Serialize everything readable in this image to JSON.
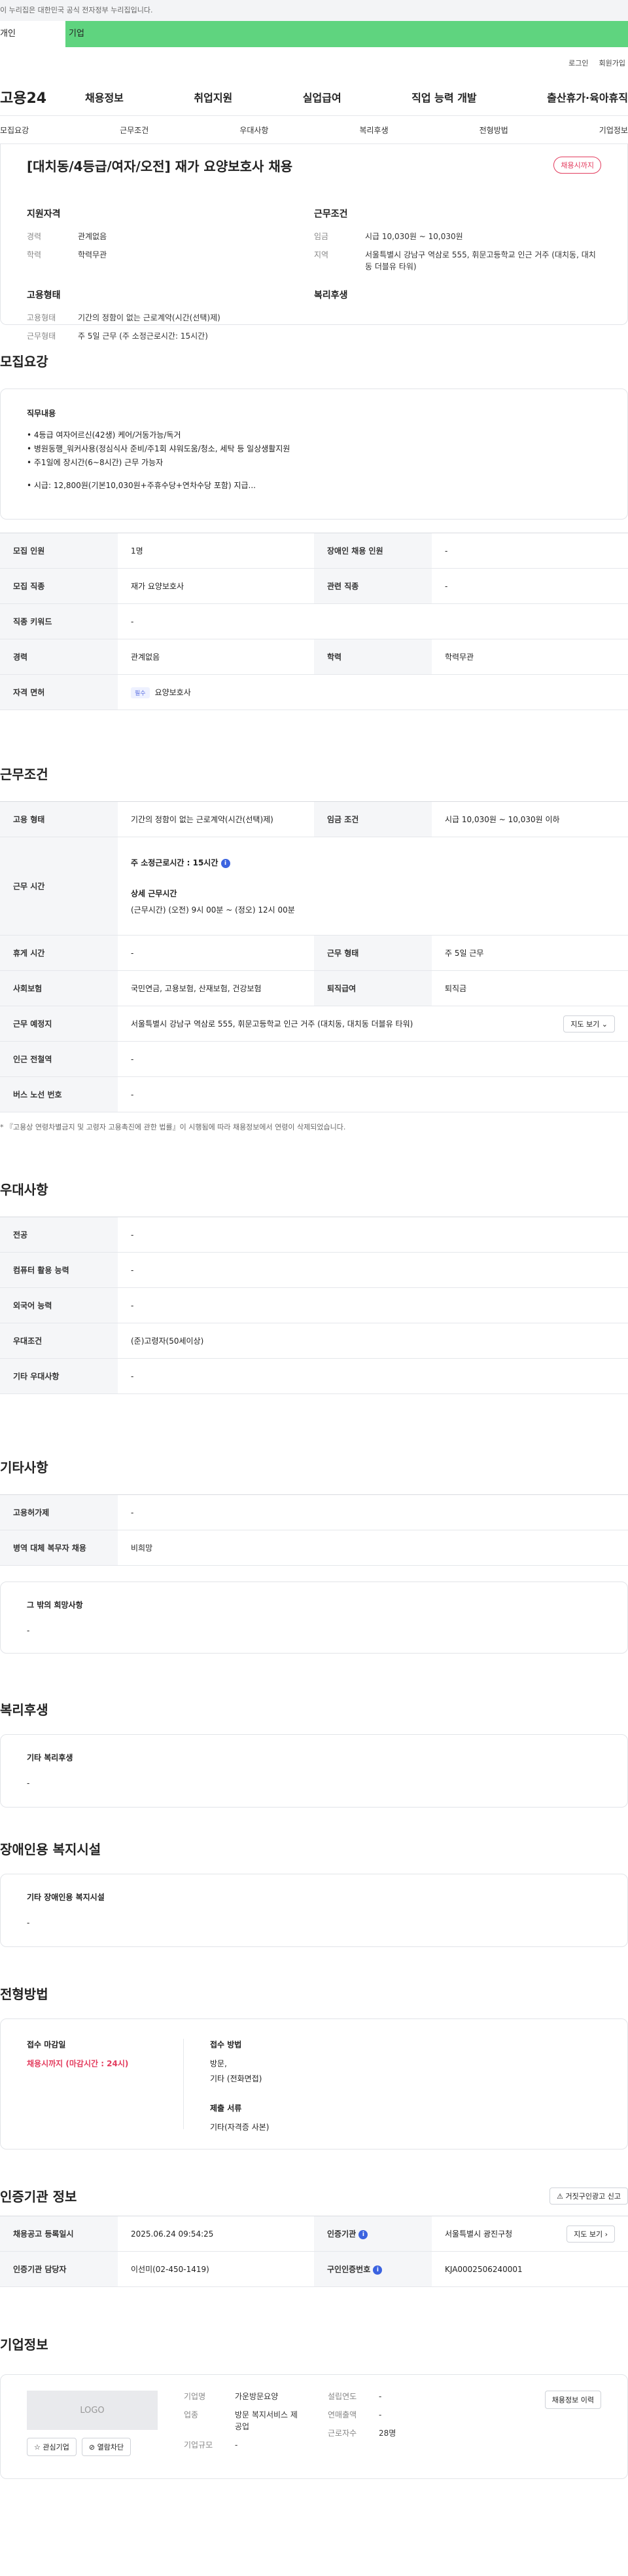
{
  "top_notice": "이 누리집은 대한민국 공식 전자정부 누리집입니다.",
  "user_tabs": [
    "개인",
    "기업"
  ],
  "util_links": [
    "로그인",
    "회원가입"
  ],
  "logo": "고용24",
  "gnb": [
    "채용정보",
    "취업지원",
    "실업급여",
    "직업 능력 개발",
    "출산휴가·육아휴직"
  ],
  "subnav": [
    "모집요강",
    "근무조건",
    "우대사항",
    "복리후생",
    "전형방법",
    "기업정보"
  ],
  "job": {
    "title": "[대치동/4등급/여자/오전] 재가 요양보호사 채용",
    "deadline_badge": "채용시까지",
    "qual_title": "지원자격",
    "qual_rows": [
      {
        "k": "경력",
        "v": "관계없음"
      },
      {
        "k": "학력",
        "v": "학력무관"
      }
    ],
    "work_title": "근무조건",
    "work_rows": [
      {
        "k": "임금",
        "v": "시급 10,030원 ~ 10,030원"
      },
      {
        "k": "지역",
        "v": "서울특별시 강남구 역삼로 555, 휘문고등학교 인근 거주 (대치동, 대치동 더블유 타워)"
      }
    ],
    "emp_title": "고용형태",
    "emp_rows": [
      {
        "k": "고용형태",
        "v": "기간의 정함이 없는 근로계약(시간(선택)제)"
      },
      {
        "k": "근무형태",
        "v": "주 5일 근무 (주 소정근로시간: 15시간)"
      }
    ],
    "welfare_title": "복리후생"
  },
  "recruit": {
    "title": "모집요강",
    "duty_title": "직무내용",
    "duties": [
      "• 4등급 여자어르신(42생) 케어/거동가능/독거",
      "• 병원동행_워커사용(정심식사 준비/주1회 샤워도움/청소, 세탁 등 일상생활지원",
      "• 주1일에 장시간(6~8시간) 근무 가능자",
      "",
      "• 시급: 12,800원(기본10,030원+주휴수당+연차수당 포함) 지급..."
    ],
    "rows": [
      [
        {
          "k": "모집 인원",
          "v": "1명"
        },
        {
          "k": "장애인 채용 인원",
          "v": "-"
        }
      ],
      [
        {
          "k": "모집 직종",
          "v": "재가 요양보호사"
        },
        {
          "k": "관련 직종",
          "v": "-"
        }
      ],
      [
        {
          "k": "직종 키워드",
          "v": "-"
        }
      ],
      [
        {
          "k": "경력",
          "v": "관계없음"
        },
        {
          "k": "학력",
          "v": "학력무관"
        }
      ]
    ],
    "license_label": "자격 면허",
    "license_tag": "필수",
    "license_value": "요양보호사"
  },
  "conditions": {
    "title": "근무조건",
    "emp_type_label": "고용 형태",
    "emp_type_value": "기간의 정함이 없는 근로계약(시간(선택)제)",
    "wage_label": "임금 조건",
    "wage_value": "시급 10,030원 ~ 10,030원 이하",
    "hours_label": "근무 시간",
    "hours_weekly": "주 소정근로시간 : 15시간",
    "hours_detail_title": "상세 근무시간",
    "hours_detail": "(근무시간) (오전) 9시 00분 ~ (정오) 12시 00분",
    "rest_label": "휴게 시간",
    "rest_value": "-",
    "work_form_label": "근무 형태",
    "work_form_value": "주 5일 근무",
    "insurance_label": "사회보험",
    "insurance_value": "국민연금, 고용보험, 산재보험, 건강보험",
    "severance_label": "퇴직급여",
    "severance_value": "퇴직금",
    "location_label": "근무 예정지",
    "location_value": "서울특별시 강남구 역삼로 555, 휘문고등학교 인근 거주 (대치동, 대치동 더블유 타워)",
    "map_button": "지도 보기",
    "subway_label": "인근 전철역",
    "subway_value": "-",
    "bus_label": "버스 노선 번호",
    "bus_value": "-",
    "note": "* 『고용상 연령차별금지 및 고령자 고용촉진에 관한 법률』이 시행됨에 따라 채용정보에서 연령이 삭제되었습니다."
  },
  "preference": {
    "title": "우대사항",
    "rows": [
      {
        "k": "전공",
        "v": "-"
      },
      {
        "k": "컴퓨터 활용 능력",
        "v": "-"
      },
      {
        "k": "외국어 능력",
        "v": "-"
      },
      {
        "k": "우대조건",
        "v": "(준)고령자(50세이상)"
      },
      {
        "k": "기타 우대사항",
        "v": "-"
      }
    ]
  },
  "other": {
    "title": "기타사항",
    "rows": [
      {
        "k": "고용허가제",
        "v": "-"
      },
      {
        "k": "병역 대체 복무자 채용",
        "v": "비희망"
      }
    ],
    "extra_title": "그 밖의 희망사항",
    "extra_value": "-"
  },
  "welfare": {
    "title": "복리후생",
    "box_title": "기타 복리후생",
    "box_value": "-"
  },
  "disability": {
    "title": "장애인용 복지시설",
    "box_title": "기타 장애인용 복지시설",
    "box_value": "-"
  },
  "selection": {
    "title": "전형방법",
    "deadline_title": "접수 마감일",
    "deadline_value": "채용시까지 (마감시간 : 24시)",
    "method_title": "접수 방법",
    "method_lines": [
      "방문,",
      "기타 (전화면접)"
    ],
    "docs_title": "제출 서류",
    "docs_value": "기타(자격증 사본)"
  },
  "agency": {
    "title": "인증기관 정보",
    "report_button": "거짓구인광고 신고",
    "reg_date_label": "채용공고 등록일시",
    "reg_date_value": "2025.06.24 09:54:25",
    "agency_label": "인증기관",
    "agency_value": "서울특별시 광진구청",
    "map_button": "지도 보기",
    "manager_label": "인증기관 담당자",
    "manager_value": "이선미(02-450-1419)",
    "cert_label": "구인인증번호",
    "cert_value": "KJA0002506240001"
  },
  "company": {
    "title": "기업정보",
    "logo_text": "LOGO",
    "fav_button": "관심기업",
    "block_button": "열람차단",
    "name_label": "기업명",
    "name_value": "가운방문요양",
    "industry_label": "업종",
    "industry_value": "방문 복지서비스 제공업",
    "size_label": "기업규모",
    "size_value": "-",
    "year_label": "설립연도",
    "year_value": "-",
    "sales_label": "연매출액",
    "sales_value": "-",
    "staff_label": "근로자수",
    "staff_value": "28명",
    "history_button": "채용정보 이력"
  }
}
